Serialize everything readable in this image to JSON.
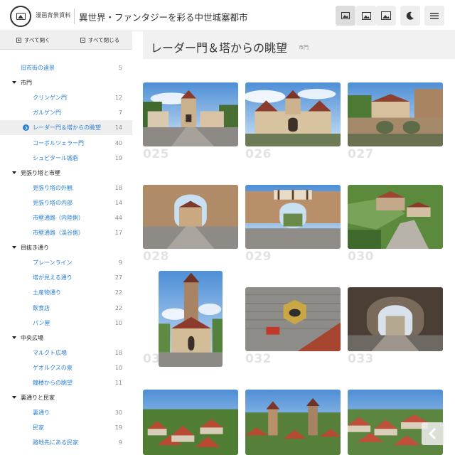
{
  "header": {
    "site_name": "漫画背景資料",
    "book_title": "異世界・ファンタジーを彩る中世城塞都市",
    "buttons": [
      {
        "name": "view-small-button",
        "icon": "image-small-icon"
      },
      {
        "name": "view-medium-button",
        "icon": "image-medium-icon"
      },
      {
        "name": "view-large-button",
        "icon": "image-large-icon"
      },
      {
        "name": "dark-mode-button",
        "icon": "moon-icon"
      },
      {
        "name": "menu-button",
        "icon": "hamburger-icon"
      }
    ]
  },
  "sidebar": {
    "expand_all": "すべて開く",
    "collapse_all": "すべて閉じる",
    "rows": [
      {
        "type": "top",
        "label": "旧市街の遠景",
        "count": "5"
      },
      {
        "type": "section",
        "label": "市門",
        "count": ""
      },
      {
        "type": "item",
        "label": "クリンゲン門",
        "count": "12"
      },
      {
        "type": "item",
        "label": "ガルゲン門",
        "count": "7"
      },
      {
        "type": "item",
        "label": "レーダー門＆塔からの眺望",
        "count": "14",
        "selected": true
      },
      {
        "type": "item",
        "label": "コーボルツェラー門",
        "count": "40"
      },
      {
        "type": "item",
        "label": "シュピタール城砦",
        "count": "19"
      },
      {
        "type": "section",
        "label": "見張り塔と市壁",
        "count": ""
      },
      {
        "type": "item",
        "label": "見張り塔の外観",
        "count": "18"
      },
      {
        "type": "item",
        "label": "見張り塔の内部",
        "count": "14"
      },
      {
        "type": "item",
        "label": "市壁通路（内陸側）",
        "count": "44"
      },
      {
        "type": "item",
        "label": "市壁通路（渓谷側）",
        "count": "17"
      },
      {
        "type": "section",
        "label": "目抜き通り",
        "count": ""
      },
      {
        "type": "item",
        "label": "プレーンライン",
        "count": "9"
      },
      {
        "type": "item",
        "label": "塔が見える通り",
        "count": "27"
      },
      {
        "type": "item",
        "label": "土産物通り",
        "count": "22"
      },
      {
        "type": "item",
        "label": "飲食店",
        "count": "22"
      },
      {
        "type": "item",
        "label": "パン屋",
        "count": "10"
      },
      {
        "type": "section",
        "label": "中央広場",
        "count": ""
      },
      {
        "type": "item",
        "label": "マルクト広場",
        "count": "18"
      },
      {
        "type": "item",
        "label": "ゲオルクスの泉",
        "count": "10"
      },
      {
        "type": "item",
        "label": "鐘楼からの眺望",
        "count": "11"
      },
      {
        "type": "section",
        "label": "裏通りと民家",
        "count": ""
      },
      {
        "type": "item",
        "label": "裏通り",
        "count": "30"
      },
      {
        "type": "item",
        "label": "民家",
        "count": "19"
      },
      {
        "type": "item",
        "label": "路地先にある民家",
        "count": "9"
      }
    ]
  },
  "main": {
    "title": "レーダー門＆塔からの眺望",
    "subtitle": "市門",
    "thumbnails": [
      {
        "number": "025",
        "scene": "gate-street"
      },
      {
        "number": "026",
        "scene": "gate-front"
      },
      {
        "number": "027",
        "scene": "stone-bridge"
      },
      {
        "number": "028",
        "scene": "arch-inside"
      },
      {
        "number": "029",
        "scene": "arch-timber"
      },
      {
        "number": "030",
        "scene": "aerial-wall"
      },
      {
        "number": "031",
        "scene": "tower-portrait"
      },
      {
        "number": "032",
        "scene": "coat-of-arms"
      },
      {
        "number": "033",
        "scene": "dark-arch"
      },
      {
        "number": "",
        "scene": "panorama-1"
      },
      {
        "number": "",
        "scene": "panorama-2"
      },
      {
        "number": "",
        "scene": "panorama-3"
      }
    ]
  },
  "colors": {
    "link": "#2a7fd4",
    "number_watermark": "#e3e3e3",
    "title_bar": "#f1f1f1"
  }
}
